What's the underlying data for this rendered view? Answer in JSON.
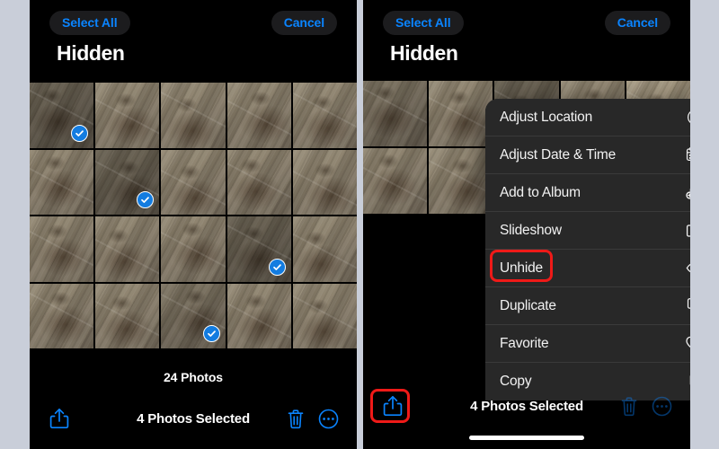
{
  "background_color": "#c9ced9",
  "accent_color": "#0a84ff",
  "highlight_color": "#ef1a18",
  "check_color": "#137ce0",
  "panels": {
    "left": {
      "name": "photos-hidden-album-selection",
      "header": {
        "select_all_label": "Select All",
        "cancel_label": "Cancel",
        "title": "Hidden"
      },
      "grid": {
        "columns": 5,
        "rows": 4,
        "selected_cells": [
          0,
          6,
          13,
          17
        ],
        "shade_map": [
          "dark",
          "",
          "",
          "",
          "",
          "",
          "dark",
          "",
          "",
          "",
          "",
          "",
          "",
          "dark",
          "",
          "",
          "",
          "dark2",
          "",
          ""
        ]
      },
      "photo_count_label": "24 Photos",
      "toolbar": {
        "share_icon": "share-icon",
        "selected_label": "4 Photos Selected",
        "trash_icon": "trash-icon",
        "more_icon": "more-circle-icon"
      }
    },
    "right": {
      "name": "photos-hidden-album-share-menu",
      "header": {
        "select_all_label": "Select All",
        "cancel_label": "Cancel",
        "title": "Hidden"
      },
      "grid": {
        "columns": 5,
        "rows": 2,
        "selected_cells": [],
        "shade_map": [
          "dark2",
          "",
          "dark",
          "",
          "light",
          "",
          "",
          "",
          "",
          ""
        ]
      },
      "toolbar": {
        "share_icon": "share-icon",
        "selected_label": "4 Photos Selected",
        "trash_icon": "trash-icon",
        "more_icon": "more-circle-icon"
      },
      "context_menu": {
        "items": [
          {
            "label": "Adjust Location",
            "icon": "location-pin-circle-icon"
          },
          {
            "label": "Adjust Date & Time",
            "icon": "calendar-clock-icon"
          },
          {
            "label": "Add to Album",
            "icon": "album-plus-icon"
          },
          {
            "label": "Slideshow",
            "icon": "play-rect-icon"
          },
          {
            "label": "Unhide",
            "icon": "eye-icon"
          },
          {
            "label": "Duplicate",
            "icon": "duplicate-icon"
          },
          {
            "label": "Favorite",
            "icon": "heart-icon"
          },
          {
            "label": "Copy",
            "icon": "copy-icon"
          }
        ],
        "highlighted_item": "Unhide"
      }
    }
  }
}
